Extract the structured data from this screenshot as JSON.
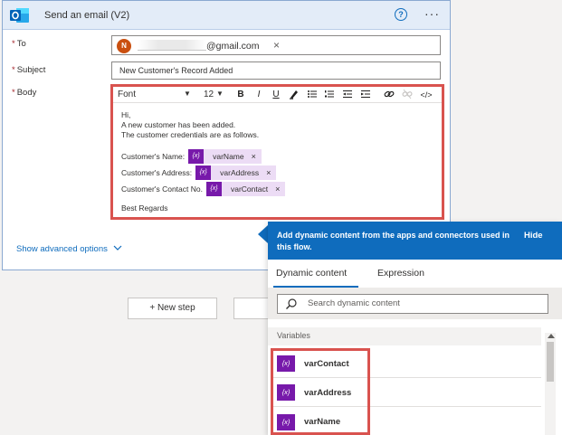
{
  "action": {
    "title": "Send an email (V2)",
    "help_glyph": "?",
    "more_glyph": "···"
  },
  "fields": {
    "to_label": "To",
    "to_avatar_initial": "N",
    "to_value": "@gmail.com",
    "to_remove_glyph": "×",
    "subject_label": "Subject",
    "subject_value": "New Customer's Record Added",
    "body_label": "Body",
    "required_marker": "*"
  },
  "editor": {
    "font": "Font",
    "font_size": "12",
    "toolbar": {
      "bold": "B",
      "italic": "I",
      "underline": "U",
      "code": "</>"
    },
    "lines": {
      "greeting": "Hi,",
      "line1": "A new customer has been added.",
      "line2": "The customer credentials are as follows.",
      "name_label": "Customer's Name:",
      "address_label": "Customer's Address:",
      "contact_label": "Customer's Contact No.",
      "closing": "Best Regards"
    },
    "tokens": {
      "icon_text": "{x}",
      "name": "varName",
      "address": "varAddress",
      "contact": "varContact",
      "remove_glyph": "×"
    }
  },
  "advanced_options": "Show advanced options",
  "new_step": "+ New step",
  "flyout": {
    "header": "Add dynamic content from the apps and connectors used in this flow.",
    "hide": "Hide",
    "tabs": [
      "Dynamic content",
      "Expression"
    ],
    "search_placeholder": "Search dynamic content",
    "section": "Variables",
    "variables": [
      "varContact",
      "varAddress",
      "varName"
    ],
    "var_icon": "{x}"
  },
  "colors": {
    "accent": "#0f6cbd",
    "variable_purple": "#7719aa",
    "highlight_red": "#d9534f"
  }
}
